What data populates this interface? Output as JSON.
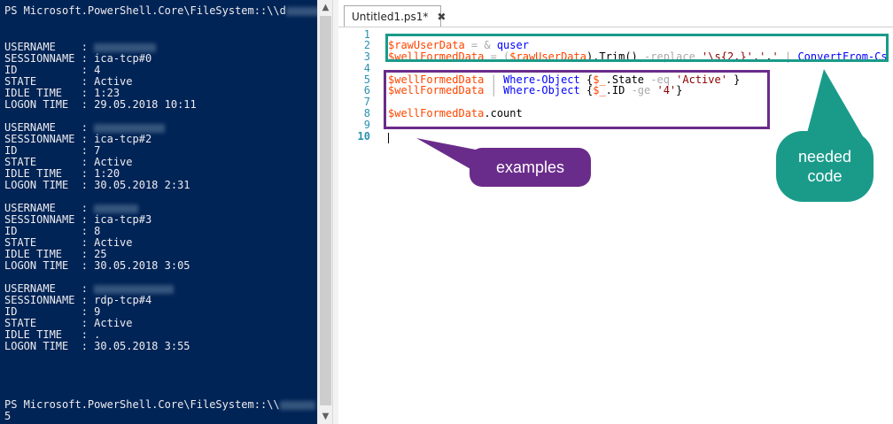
{
  "console": {
    "prompt_top": "PS Microsoft.PowerShell.Core\\FileSystem::\\\\d",
    "prompt_bottom": "PS Microsoft.PowerShell.Core\\FileSystem::\\\\",
    "result": "5",
    "sessions": [
      {
        "username": "",
        "sessionname": "ica-tcp#0",
        "id": "4",
        "state": "Active",
        "idle_time": "1:23",
        "logon_time": "29.05.2018 10:11"
      },
      {
        "username": "",
        "sessionname": "ica-tcp#2",
        "id": "7",
        "state": "Active",
        "idle_time": "1:20",
        "logon_time": "30.05.2018 2:31"
      },
      {
        "username": "",
        "sessionname": "ica-tcp#3",
        "id": "8",
        "state": "Active",
        "idle_time": "25",
        "logon_time": "30.05.2018 3:05"
      },
      {
        "username": "",
        "sessionname": "rdp-tcp#4",
        "id": "9",
        "state": "Active",
        "idle_time": ".",
        "logon_time": "30.05.2018 3:55"
      }
    ],
    "labels": {
      "username": "USERNAME    : ",
      "sessionname": "SESSIONNAME : ",
      "id": "ID          : ",
      "state": "STATE       : ",
      "idle_time": "IDLE TIME   : ",
      "logon_time": "LOGON TIME  : "
    }
  },
  "scrollbar": {
    "up_icon": "▲",
    "down_icon": "▼"
  },
  "editor": {
    "tab_title": "Untitled1.ps1*",
    "tab_close": "✖",
    "line_numbers": [
      "1",
      "2",
      "3",
      "4",
      "5",
      "6",
      "7",
      "8",
      "9",
      "10"
    ],
    "line2": {
      "var": "$rawUserData",
      "op": " = & ",
      "cmd": "quser"
    },
    "line3": {
      "var": "$wellFormedData",
      "op1": " = (",
      "var2": "$rawUserData",
      "t1": ").Trim() ",
      "op2": "-replace ",
      "str": "'\\s{2,}','",
      "t2": ",",
      "str2": "'",
      "op3": " | ",
      "cmd": "ConvertFrom-Cs"
    },
    "line5": {
      "var": "$wellFormedData",
      "op": " | ",
      "cmd": "Where-Object",
      "t1": " {",
      "var2": "$_",
      "t2": ".State ",
      "op2": "-eq ",
      "str": "'Active'",
      "t3": " }"
    },
    "line6": {
      "var": "$wellFormedData",
      "op": " | ",
      "cmd": "Where-Object",
      "t1": " {",
      "var2": "$_",
      "t2": ".ID ",
      "op2": "-ge ",
      "str": "'4'",
      "t3": "}"
    },
    "line8": {
      "var": "$wellFormedData",
      "t1": ".count"
    }
  },
  "annotations": {
    "examples": "examples",
    "needed_code_1": "needed",
    "needed_code_2": "code"
  },
  "colors": {
    "console_bg": "#012456",
    "teal": "#1a9b8a",
    "purple": "#6a2c8a"
  }
}
